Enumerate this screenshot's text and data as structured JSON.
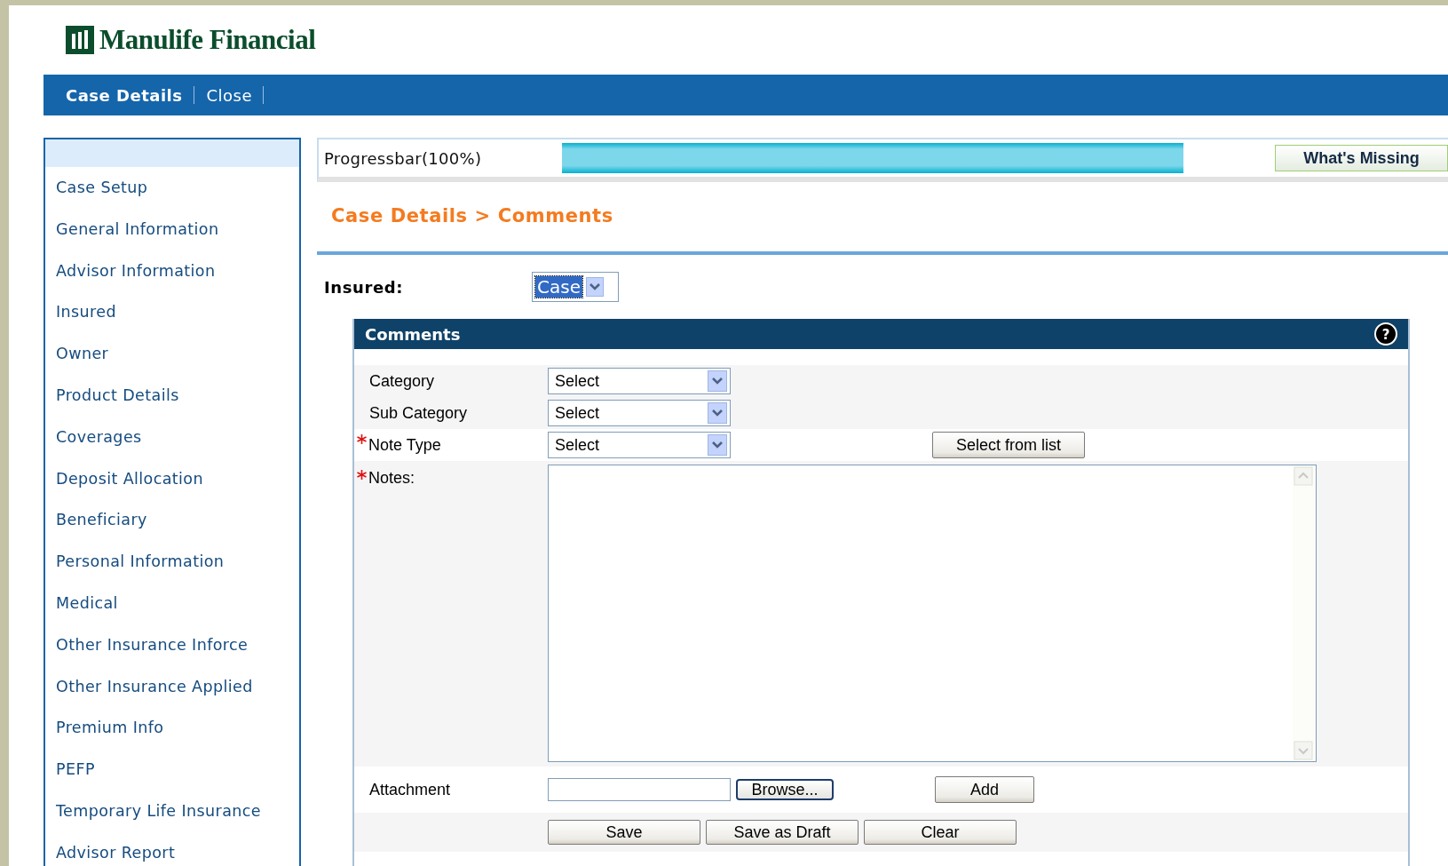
{
  "logo": {
    "text": "Manulife Financial"
  },
  "nav": [
    {
      "label": "Case Details",
      "selected": true
    },
    {
      "label": "Close",
      "selected": false
    }
  ],
  "sidebar": {
    "items": [
      {
        "label": "Case Setup"
      },
      {
        "label": "General Information"
      },
      {
        "label": "Advisor Information"
      },
      {
        "label": "Insured"
      },
      {
        "label": "Owner"
      },
      {
        "label": "Product Details"
      },
      {
        "label": "Coverages"
      },
      {
        "label": "Deposit Allocation"
      },
      {
        "label": "Beneficiary"
      },
      {
        "label": "Personal Information"
      },
      {
        "label": "Medical"
      },
      {
        "label": "Other Insurance Inforce"
      },
      {
        "label": "Other Insurance Applied"
      },
      {
        "label": "Premium Info"
      },
      {
        "label": "PEFP"
      },
      {
        "label": "Temporary Life Insurance"
      },
      {
        "label": "Advisor Report"
      }
    ]
  },
  "progress": {
    "label": "Progressbar(100%)",
    "level": 1.0,
    "button": "What's Missing"
  },
  "breadcrumb": "Case Details > Comments",
  "insured": {
    "label": "Insured:",
    "value": "Case"
  },
  "comments": {
    "title": "Comments",
    "help": "?",
    "fields": [
      {
        "label": "Category",
        "required": false,
        "value": "Select"
      },
      {
        "label": "Sub Category",
        "required": false,
        "value": "Select"
      },
      {
        "label": "Note Type",
        "required": true,
        "value": "Select",
        "button": "Select from list"
      }
    ],
    "notes": {
      "label": "Notes:",
      "required": true
    },
    "attachment": {
      "label": "Attachment",
      "browse": "Browse...",
      "add": "Add"
    },
    "buttons": [
      "Save",
      "Save as Draft",
      "Clear"
    ]
  }
}
